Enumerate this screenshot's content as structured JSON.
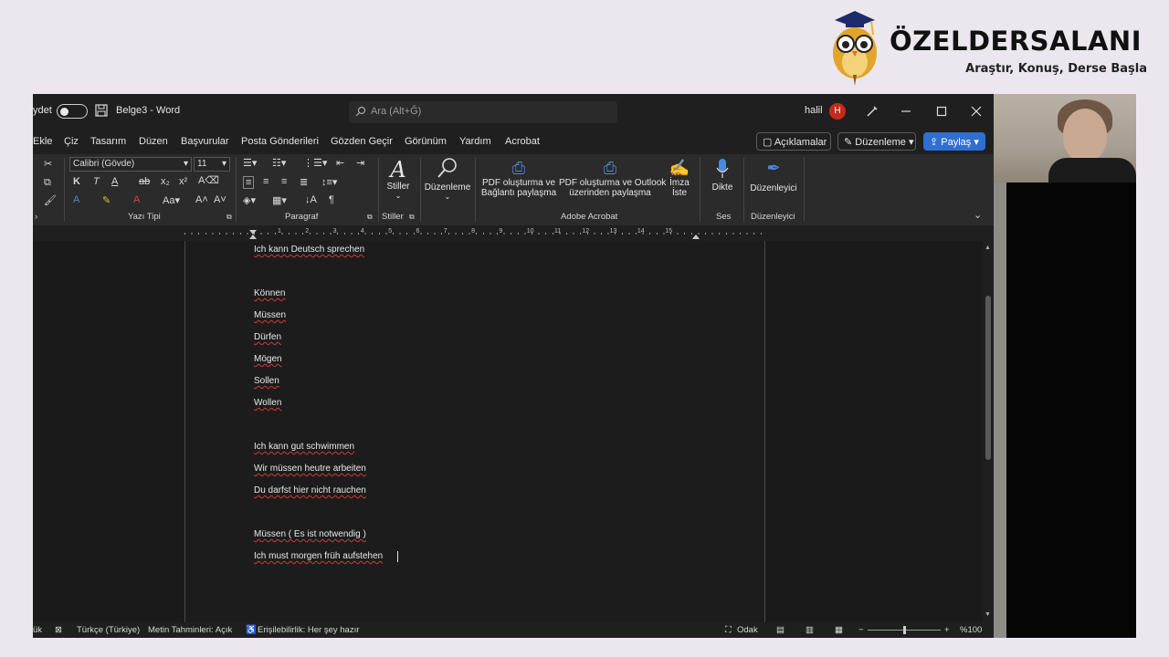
{
  "brand": {
    "title": "ÖZELDERSALANI",
    "tagline": "Araştır, Konuş, Derse Başla"
  },
  "titlebar": {
    "autosave": "ydet",
    "doc_title": "Belge3 - Word",
    "search_placeholder": "Ara (Alt+Ğ)",
    "user": "halil",
    "avatar_initial": "H"
  },
  "menu": {
    "items": [
      "Ekle",
      "Çiz",
      "Tasarım",
      "Düzen",
      "Başvurular",
      "Posta Gönderileri",
      "Gözden Geçir",
      "Görünüm",
      "Yardım",
      "Acrobat"
    ],
    "comments": "Açıklamalar",
    "editing": "Düzenleme",
    "share": "Paylaş"
  },
  "ribbon": {
    "font_name": "Calibri (Gövde)",
    "font_size": "11",
    "groups": {
      "font": "Yazı Tipi",
      "paragraph": "Paragraf",
      "styles": "Stiller",
      "acrobat": "Adobe Acrobat",
      "voice": "Ses",
      "editor": "Düzenleyici"
    },
    "styles_label": "Stiller",
    "editing_label": "Düzenleme",
    "pdf_link": [
      "PDF oluşturma ve",
      "Bağlantı paylaşma"
    ],
    "pdf_outlook": [
      "PDF oluşturma ve Outlook",
      "üzerinden paylaşma"
    ],
    "sign": [
      "İmza",
      "İste"
    ],
    "dictate": "Dikte",
    "editor_label": "Düzenleyici"
  },
  "ruler": {
    "numbers": [
      "1",
      "2",
      "3",
      "4",
      "5",
      "6",
      "7",
      "8",
      "9",
      "10",
      "11",
      "12",
      "13",
      "14",
      "15"
    ]
  },
  "document": {
    "lines": [
      "Ich kann Deutsch sprechen",
      "Können",
      "Müssen",
      "Dürfen",
      "Mögen",
      "Sollen",
      "Wollen",
      "Ich kann gut schwimmen",
      "Wir müssen heutre arbeiten",
      "Du darfst hier nicht rauchen",
      "Müssen ( Es ist  notwendig )",
      "Ich must morgen früh aufstehen"
    ]
  },
  "status": {
    "words": "ük",
    "language": "Türkçe (Türkiye)",
    "predictions": "Metin Tahminleri: Açık",
    "accessibility": "Erişilebilirlik: Her şey hazır",
    "focus": "Odak",
    "zoom": "%100"
  },
  "colors": {
    "accent": "#2f6fd1",
    "avatar": "#c42b1c",
    "spell_underline": "#d13a3a"
  }
}
